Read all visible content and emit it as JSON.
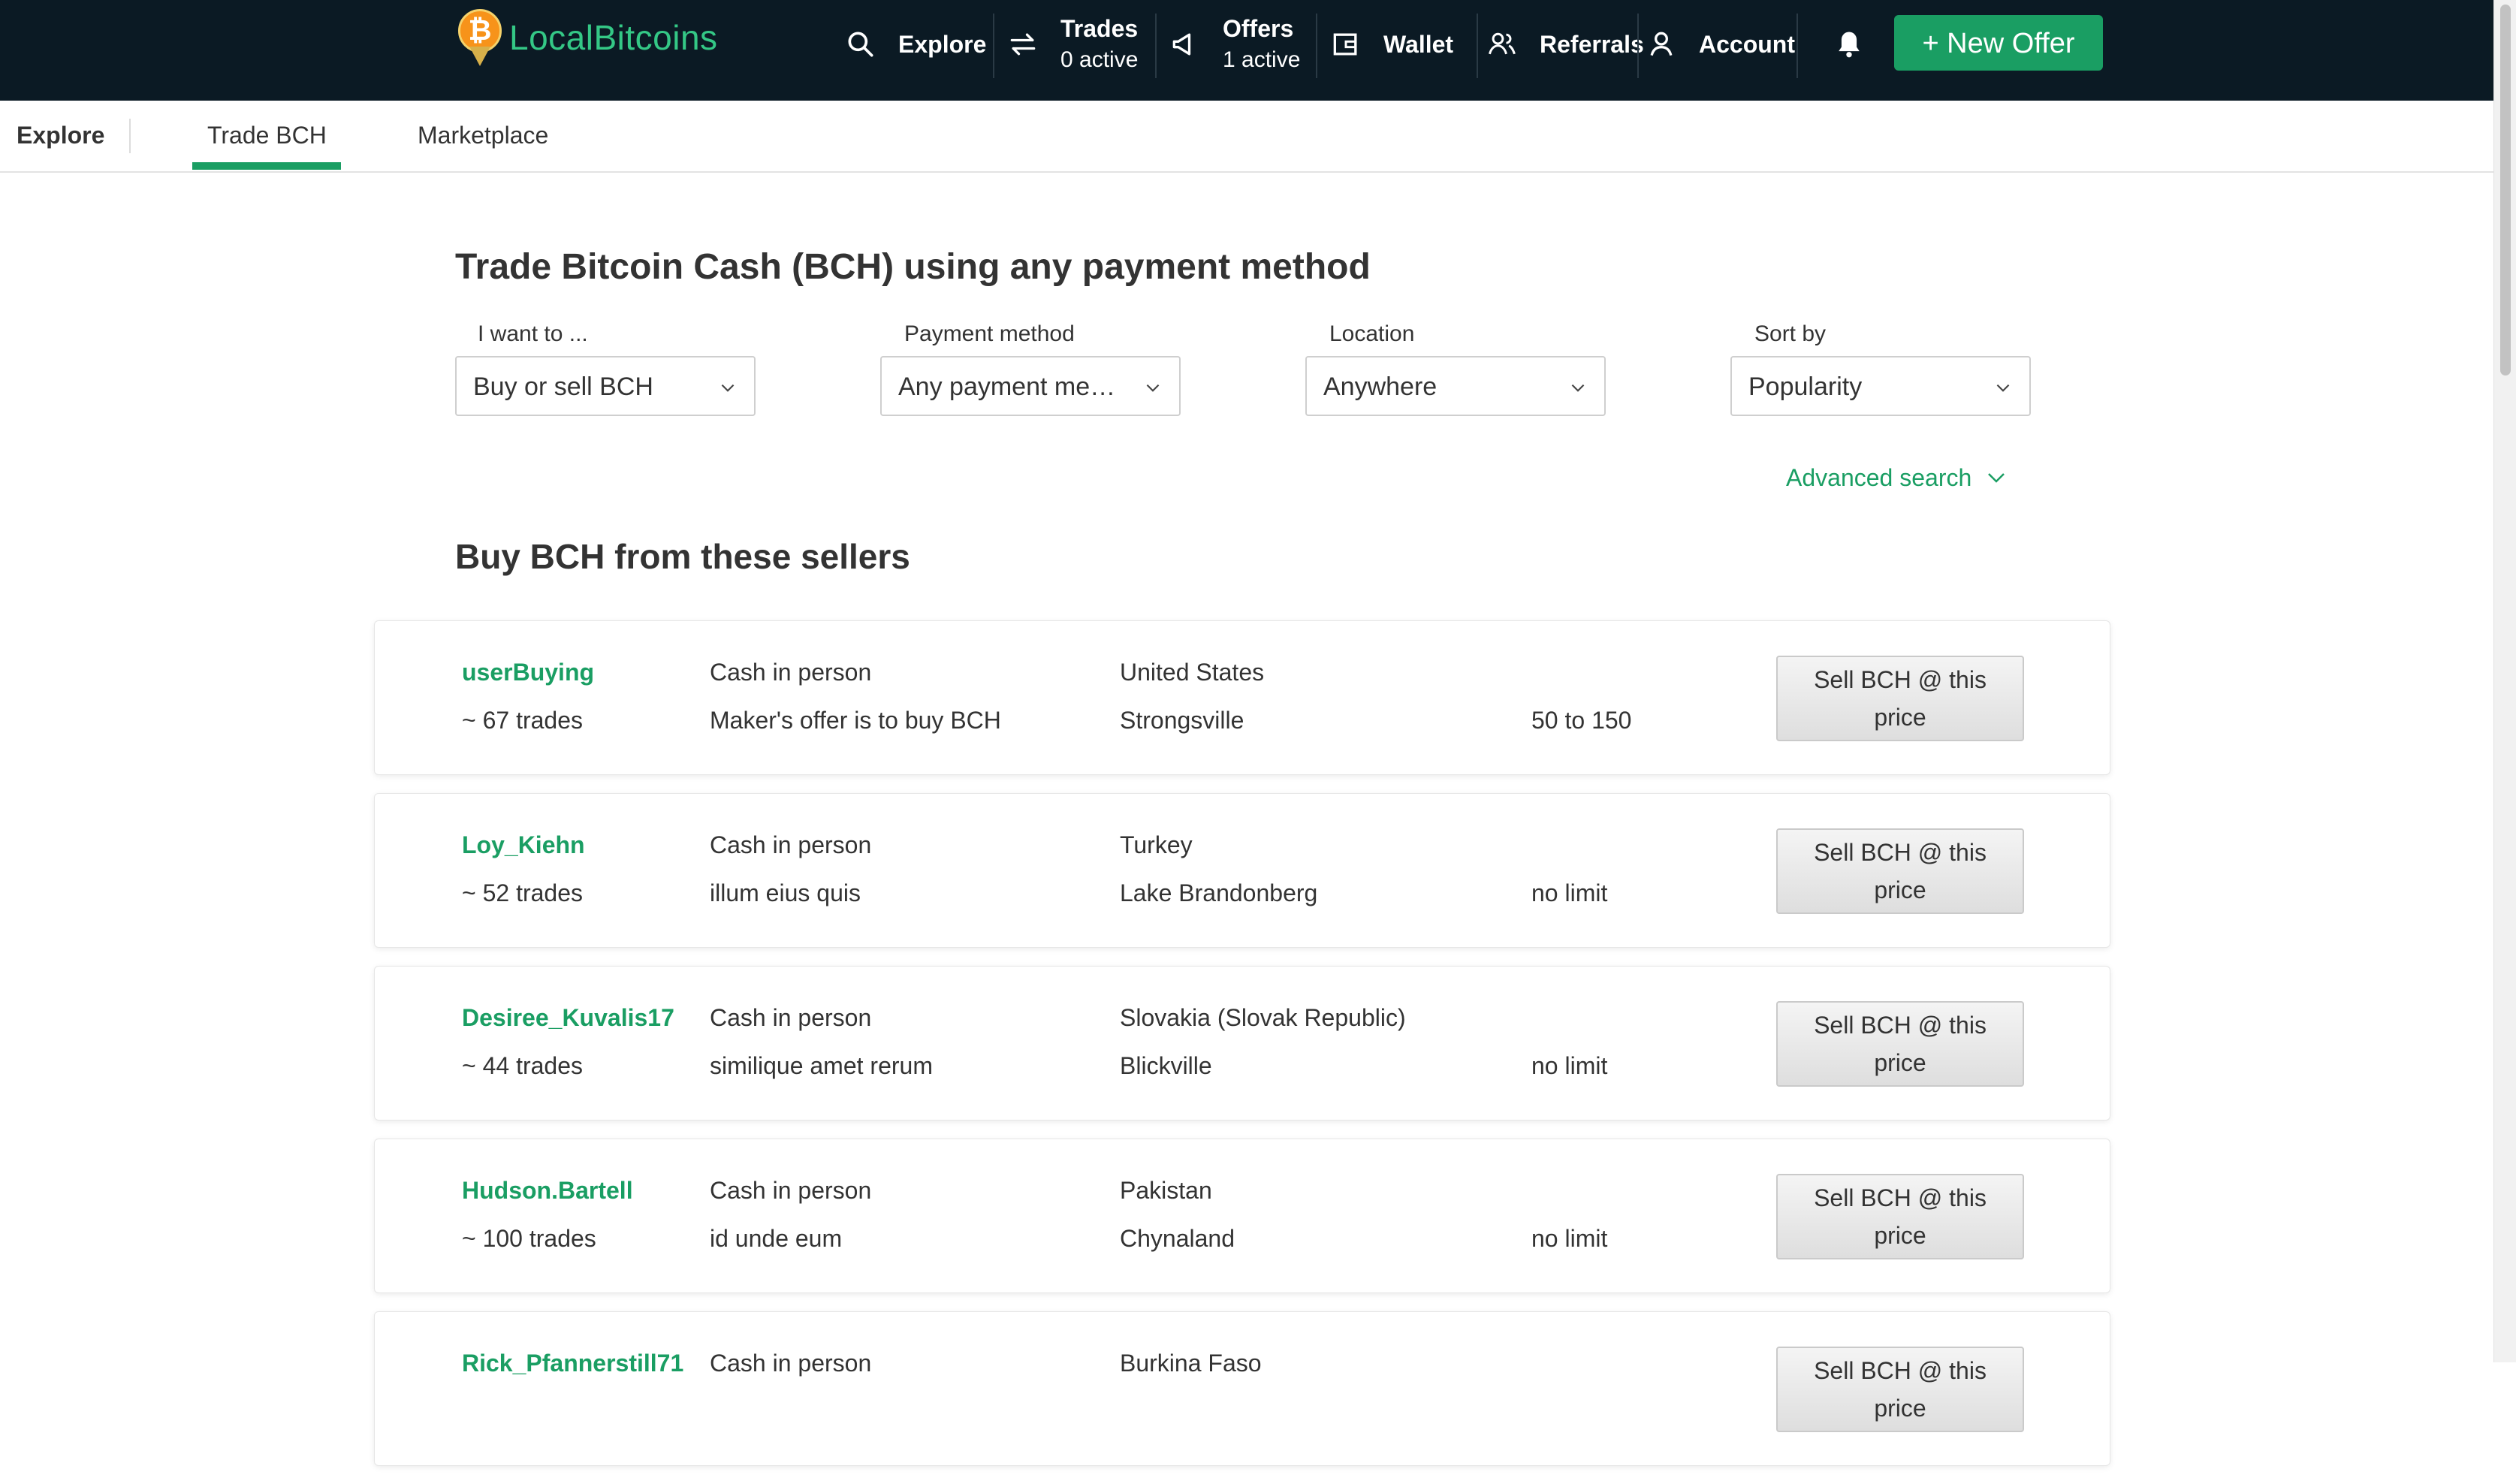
{
  "brand": {
    "name": "LocalBitcoins",
    "logo_glyph": "₿",
    "accent": "#1a9e63",
    "nav_bg": "#0b1a24"
  },
  "topnav": {
    "explore": "Explore",
    "trades": {
      "label": "Trades",
      "sub": "0 active"
    },
    "offers": {
      "label": "Offers",
      "sub": "1 active"
    },
    "wallet": "Wallet",
    "referrals": "Referrals",
    "account": "Account",
    "new_offer": "+ New Offer"
  },
  "subnav": {
    "section": "Explore",
    "tabs": [
      "Trade BCH",
      "Marketplace"
    ],
    "active_tab": "Trade BCH"
  },
  "page": {
    "title": "Trade Bitcoin Cash (BCH) using any payment method",
    "filters": [
      {
        "label": "I want to ...",
        "value": "Buy or sell BCH"
      },
      {
        "label": "Payment method",
        "value": "Any payment me…"
      },
      {
        "label": "Location",
        "value": "Anywhere"
      },
      {
        "label": "Sort by",
        "value": "Popularity"
      }
    ],
    "advanced_search": "Advanced search",
    "section_title": "Buy BCH from these sellers"
  },
  "offers": [
    {
      "user": "userBuying",
      "trades": "~ 67 trades",
      "method": "Cash in person",
      "note": "Maker's offer is to buy BCH",
      "country": "United States",
      "city": "Strongsville",
      "limit": "50 to 150",
      "button": "Sell BCH @ this price"
    },
    {
      "user": "Loy_Kiehn",
      "trades": "~ 52 trades",
      "method": "Cash in person",
      "note": "illum eius quis",
      "country": "Turkey",
      "city": "Lake Brandonberg",
      "limit": "no limit",
      "button": "Sell BCH @ this price"
    },
    {
      "user": "Desiree_Kuvalis17",
      "trades": "~ 44 trades",
      "method": "Cash in person",
      "note": "similique amet rerum",
      "country": "Slovakia (Slovak Republic)",
      "city": "Blickville",
      "limit": "no limit",
      "button": "Sell BCH @ this price"
    },
    {
      "user": "Hudson.Bartell",
      "trades": "~ 100 trades",
      "method": "Cash in person",
      "note": "id unde eum",
      "country": "Pakistan",
      "city": "Chynaland",
      "limit": "no limit",
      "button": "Sell BCH @ this price"
    },
    {
      "user": "Rick_Pfannerstill71",
      "trades": "",
      "method": "Cash in person",
      "note": "",
      "country": "Burkina Faso",
      "city": "",
      "limit": "",
      "button": "Sell BCH @ this price"
    }
  ]
}
